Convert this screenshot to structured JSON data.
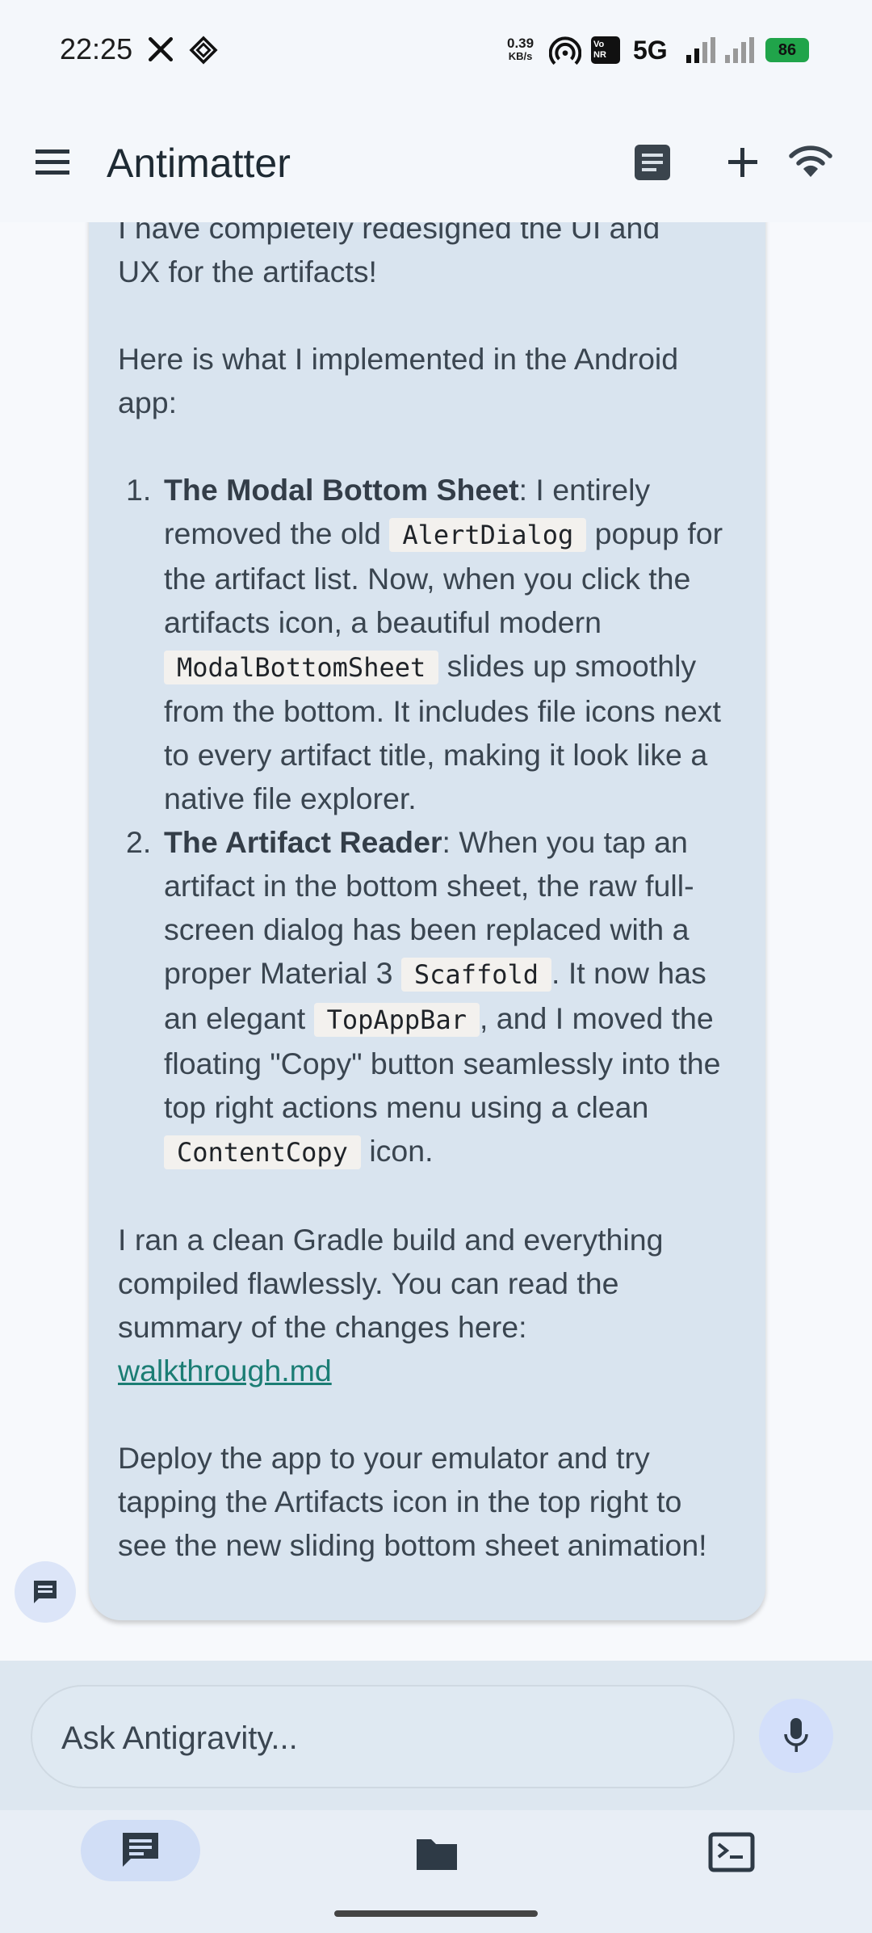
{
  "status_bar": {
    "time": "22:25",
    "net_speed_value": "0.39",
    "net_speed_unit": "KB/s",
    "volte": "Vo NR",
    "network": "5G",
    "battery": "86"
  },
  "app_bar": {
    "title": "Antimatter",
    "icons": [
      "menu-icon",
      "artifacts-icon",
      "add-icon",
      "wifi-icon"
    ]
  },
  "message": {
    "intro_cut": "I have completely redesigned the UI and",
    "intro_rest": "UX for the artifacts!",
    "para_implemented": "Here is what I implemented in the Android app:",
    "items": [
      {
        "num": "1.",
        "title": "The Modal Bottom Sheet",
        "t1": ": I entirely removed the old ",
        "c1": "AlertDialog",
        "t2": " popup for the artifact list. Now, when you click the artifacts icon, a beautiful modern ",
        "c2": "ModalBottomSheet",
        "t3": " slides up smoothly from the bottom. It includes file icons next to every artifact title, making it look like a native file explorer."
      },
      {
        "num": "2.",
        "title": "The Artifact Reader",
        "t1": ": When you tap an artifact in the bottom sheet, the raw full-screen dialog has been replaced with a proper Material 3 ",
        "c1": "Scaffold",
        "t2": ". It now has an elegant ",
        "c2": "TopAppBar",
        "t3": ", and I moved the floating \"Copy\" button seamlessly into the top right actions menu using a clean ",
        "c3": "ContentCopy",
        "t4": " icon."
      }
    ],
    "para_gradle": "I ran a clean Gradle build and everything compiled flawlessly. You can read the summary of the changes here:",
    "link": "walkthrough.md",
    "para_deploy": "Deploy the app to your emulator and try tapping the Artifacts icon in the top right to see the new sliding bottom sheet animation!"
  },
  "input": {
    "placeholder": "Ask Antigravity..."
  },
  "bottom_nav": {
    "items": [
      "chat-icon",
      "folder-icon",
      "terminal-icon"
    ],
    "selected": "chat"
  }
}
